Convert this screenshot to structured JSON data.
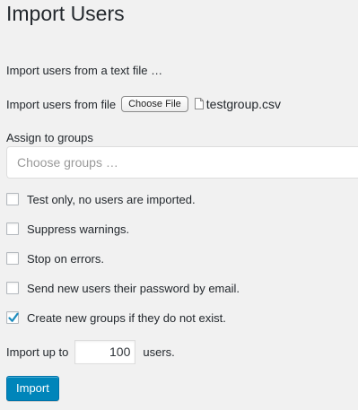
{
  "page": {
    "title": "Import Users",
    "intro": "Import users from a text file …"
  },
  "file": {
    "label": "Import users from file",
    "button_label": "Choose File",
    "selected_file": "testgroup.csv",
    "icon": "file-icon"
  },
  "groups": {
    "label": "Assign to groups",
    "placeholder": "Choose groups …",
    "value": ""
  },
  "options": [
    {
      "label": "Test only, no users are imported.",
      "checked": false
    },
    {
      "label": "Suppress warnings.",
      "checked": false
    },
    {
      "label": "Stop on errors.",
      "checked": false
    },
    {
      "label": "Send new users their password by email.",
      "checked": false
    },
    {
      "label": "Create new groups if they do not exist.",
      "checked": true
    }
  ],
  "limit": {
    "prefix": "Import up to",
    "value": "100",
    "suffix": "users."
  },
  "import_button_label": "Import",
  "colors": {
    "background": "#f1f1f1",
    "primary_button": "#0085ba",
    "checkmark": "#1e8cbe"
  }
}
